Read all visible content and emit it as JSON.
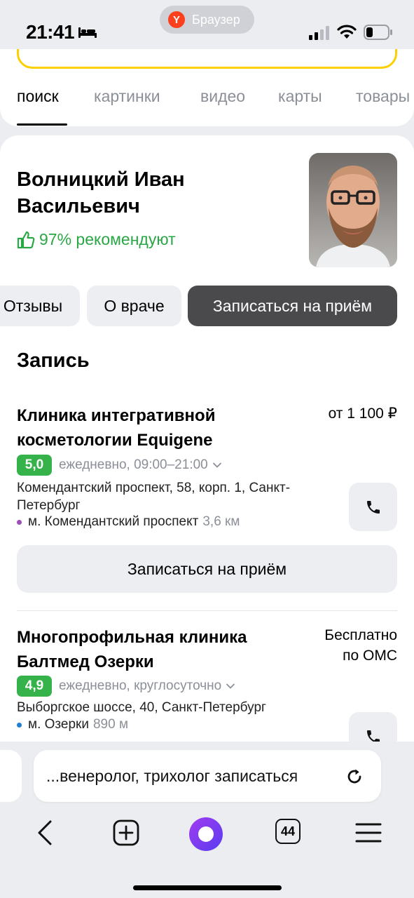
{
  "status_bar": {
    "time": "21:41",
    "browser_name": "Браузер",
    "browser_logo_letter": "Y"
  },
  "search_tabs": [
    {
      "label": "поиск",
      "active": true
    },
    {
      "label": "картинки",
      "active": false
    },
    {
      "label": "видео",
      "active": false
    },
    {
      "label": "карты",
      "active": false
    },
    {
      "label": "товары",
      "active": false
    }
  ],
  "doctor": {
    "name": "Волницкий Иван Васильевич",
    "recommend": "97% рекомендуют"
  },
  "chips": [
    "Отзывы",
    "О враче",
    "Записаться на приём"
  ],
  "booking": {
    "title": "Запись",
    "clinics": [
      {
        "name": "Клиника интегративной косметологии Equigene",
        "price": "от 1 100 ₽",
        "rating": "5,0",
        "hours": "ежедневно, 09:00–21:00",
        "address": "Комендантский проспект, 58, корп. 1, Санкт-Петербург",
        "metro": "м. Комендантский проспект",
        "metro_distance": "3,6 км",
        "metro_color": "#9b4fb8",
        "book_label": "Записаться на приём"
      },
      {
        "name": "Многопрофильная клиника Балтмед Озерки",
        "price": "Бесплатно по ОМС",
        "rating": "4,9",
        "hours": "ежедневно, круглосуточно",
        "address": "Выборгское шоссе, 40, Санкт-Петербург",
        "metro": "м. Озерки",
        "metro_distance": "890 м",
        "metro_color": "#1f7fd1"
      }
    ]
  },
  "browser": {
    "address_text": "...венеролог, трихолог записаться",
    "tabs_count": "44"
  },
  "colors": {
    "accent_green": "#29a745",
    "rating_green": "#35b34a",
    "search_yellow": "#fcd000",
    "alice_purple": "#7b3cf0"
  }
}
